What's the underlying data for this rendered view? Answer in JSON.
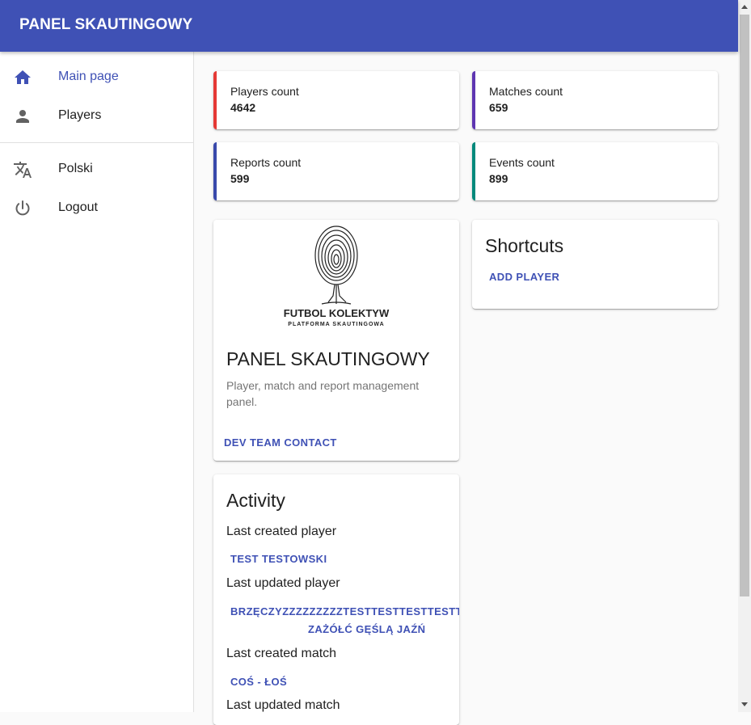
{
  "appbar": {
    "title": "PANEL SKAUTINGOWY"
  },
  "sidebar": {
    "items": [
      {
        "label": "Main page",
        "icon": "home-icon",
        "active": true
      },
      {
        "label": "Players",
        "icon": "person-icon",
        "active": false
      }
    ],
    "secondary": [
      {
        "label": "Polski",
        "icon": "translate-icon"
      },
      {
        "label": "Logout",
        "icon": "power-icon"
      }
    ]
  },
  "stats": {
    "players": {
      "label": "Players count",
      "value": "4642",
      "color": "#e53935"
    },
    "matches": {
      "label": "Matches count",
      "value": "659",
      "color": "#5e35b1"
    },
    "reports": {
      "label": "Reports count",
      "value": "599",
      "color": "#3949ab"
    },
    "events": {
      "label": "Events count",
      "value": "899",
      "color": "#00897b"
    }
  },
  "about": {
    "logo_text": "FUTBOL KOLEKTYW",
    "logo_subtext": "PLATFORMA SKAUTINGOWA",
    "title": "PANEL SKAUTINGOWY",
    "description": "Player, match and report management panel.",
    "contact_label": "DEV TEAM CONTACT"
  },
  "shortcuts": {
    "title": "Shortcuts",
    "add_player_label": "ADD PLAYER"
  },
  "activity": {
    "title": "Activity",
    "last_created_player_label": "Last created player",
    "last_created_player": "TEST TESTOWSKI",
    "last_updated_player_label": "Last updated player",
    "last_updated_player_line1": "BRZĘCZYZZZZZZZZZTESTTESTTESTTESTTES",
    "last_updated_player_line2": "ZAŻÓŁĆ GĘŚLĄ JAŹŃ",
    "last_created_match_label": "Last created match",
    "last_created_match": "COŚ - ŁOŚ",
    "last_updated_match_label": "Last updated match"
  },
  "colors": {
    "primary": "#3f51b5"
  }
}
